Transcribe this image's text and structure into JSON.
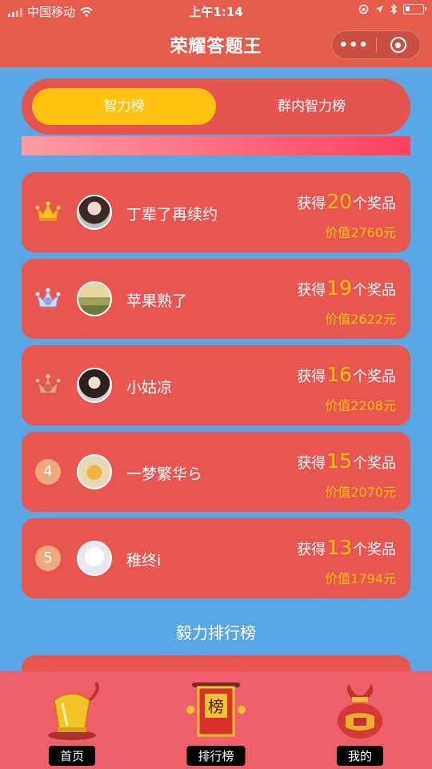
{
  "status_bar": {
    "carrier": "中国移动",
    "time": "上午1:14"
  },
  "nav": {
    "title": "荣耀答题王",
    "more_label": "•••"
  },
  "tabs": [
    {
      "label": "智力榜",
      "active": true
    },
    {
      "label": "群内智力榜",
      "active": false
    }
  ],
  "ranking": [
    {
      "rank": "1",
      "rank_icon": "gold-crown-icon",
      "name": "丁辈了再续约",
      "prize_prefix": "获得",
      "count": "20",
      "prize_suffix": "个奖品",
      "value": "价值2760元"
    },
    {
      "rank": "2",
      "rank_icon": "silver-crown-icon",
      "name": "苹果熟了",
      "prize_prefix": "获得",
      "count": "19",
      "prize_suffix": "个奖品",
      "value": "价值2622元"
    },
    {
      "rank": "3",
      "rank_icon": "bronze-crown-icon",
      "name": "小姑凉",
      "prize_prefix": "获得",
      "count": "16",
      "prize_suffix": "个奖品",
      "value": "价值2208元"
    },
    {
      "rank": "4",
      "rank_icon": "",
      "name": "一梦繁华ら",
      "prize_prefix": "获得",
      "count": "15",
      "prize_suffix": "个奖品",
      "value": "价值2070元"
    },
    {
      "rank": "5",
      "rank_icon": "",
      "name": "稚终i",
      "prize_prefix": "获得",
      "count": "13",
      "prize_suffix": "个奖品",
      "value": "价值1794元"
    }
  ],
  "section_title": "毅力排行榜",
  "tabbar": [
    {
      "label": "首页",
      "icon": "trophy-icon"
    },
    {
      "label": "排行榜",
      "icon": "ranking-scroll-icon",
      "icon_text": "榜"
    },
    {
      "label": "我的",
      "icon": "gift-bag-icon"
    }
  ],
  "colors": {
    "header": "#e65c4a",
    "page_background": "#5aa7e6",
    "row_background": "#e95650",
    "accent_yellow": "#ffc20e",
    "tabbar": "#ef5f69"
  }
}
